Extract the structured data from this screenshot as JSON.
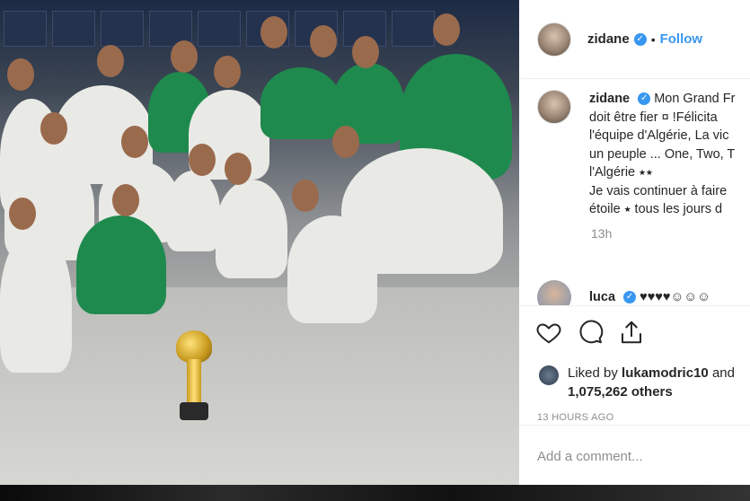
{
  "post": {
    "image_alt": "Algerian team celebrating with the trophy in the locker room",
    "author": "zidane",
    "follow_label": "Follow",
    "separator": "•"
  },
  "caption": {
    "author": "zidane",
    "lines": [
      "Mon Grand Fr",
      "doit être fier",
      "l'équipe d'Algérie, La vic",
      "un peuple ... One, Two, T",
      "l'Algérie ⭑⭑",
      "Je vais continuer à faire",
      "étoile ⭑ tous les jours d"
    ],
    "line2_extra": "!Félicita",
    "emoji_box": "¤",
    "time": "13h"
  },
  "reply": {
    "author": "luca",
    "text": "♥♥♥♥☺☺☺"
  },
  "likes": {
    "prefix": "Liked by",
    "user": "lukamodric10",
    "suffix": "and",
    "count": "1,075,262 others"
  },
  "timestamp": "13 HOURS AGO",
  "add_comment_placeholder": "Add a comment...",
  "colors": {
    "accent": "#3897f0",
    "text": "#262626",
    "muted": "#8e8e8e"
  },
  "icons": [
    "heart-icon",
    "comment-icon",
    "share-icon",
    "verified-icon"
  ]
}
